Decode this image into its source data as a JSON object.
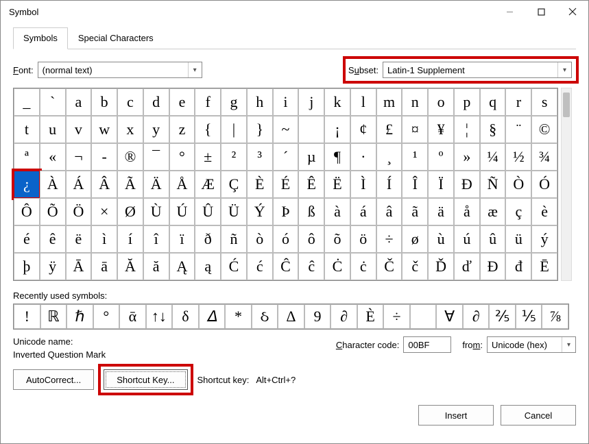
{
  "window": {
    "title": "Symbol"
  },
  "tabs": {
    "symbols": "Symbols",
    "special": "Special Characters"
  },
  "font": {
    "label": "Font:",
    "value": "(normal text)"
  },
  "subset": {
    "label": "Subset:",
    "value": "Latin-1 Supplement"
  },
  "grid": {
    "rows": [
      [
        "_",
        "`",
        "a",
        "b",
        "c",
        "d",
        "e",
        "f",
        "g",
        "h",
        "i",
        "j",
        "k",
        "l",
        "m",
        "n",
        "o",
        "p",
        "q",
        "r",
        "s"
      ],
      [
        "t",
        "u",
        "v",
        "w",
        "x",
        "y",
        "z",
        "{",
        "|",
        "}",
        "~",
        "",
        "¡",
        "¢",
        "£",
        "¤",
        "¥",
        "¦",
        "§",
        "¨",
        "©"
      ],
      [
        "ª",
        "«",
        "¬",
        "-",
        "®",
        "¯",
        "°",
        "±",
        "²",
        "³",
        "´",
        "µ",
        "¶",
        "·",
        "¸",
        "¹",
        "º",
        "»",
        "¼",
        "½",
        "¾"
      ],
      [
        "¿",
        "À",
        "Á",
        "Â",
        "Ã",
        "Ä",
        "Å",
        "Æ",
        "Ç",
        "È",
        "É",
        "Ê",
        "Ë",
        "Ì",
        "Í",
        "Î",
        "Ï",
        "Ð",
        "Ñ",
        "Ò",
        "Ó"
      ],
      [
        "Ô",
        "Õ",
        "Ö",
        "×",
        "Ø",
        "Ù",
        "Ú",
        "Û",
        "Ü",
        "Ý",
        "Þ",
        "ß",
        "à",
        "á",
        "â",
        "ã",
        "ä",
        "å",
        "æ",
        "ç",
        "è"
      ],
      [
        "é",
        "ê",
        "ë",
        "ì",
        "í",
        "î",
        "ï",
        "ð",
        "ñ",
        "ò",
        "ó",
        "ô",
        "õ",
        "ö",
        "÷",
        "ø",
        "ù",
        "ú",
        "û",
        "ü",
        "ý"
      ],
      [
        "þ",
        "ÿ",
        "Ā",
        "ā",
        "Ă",
        "ă",
        "Ą",
        "ą",
        "Ć",
        "ć",
        "Ĉ",
        "ĉ",
        "Ċ",
        "ċ",
        "Č",
        "č",
        "Ď",
        "ď",
        "Đ",
        "đ",
        "Ē"
      ]
    ],
    "selected_row": 3,
    "selected_col": 0
  },
  "recent": {
    "label": "Recently used symbols:",
    "items": [
      "!",
      "ℝ",
      "ℏ",
      "°",
      "ᾱ",
      "↑↓",
      "δ",
      "𝛥",
      "*",
      "ઠ",
      "Δ",
      "9",
      "∂",
      "È",
      "÷",
      "",
      "∀",
      "∂",
      "⅖",
      "⅕",
      "⅞"
    ]
  },
  "unicode": {
    "name_label": "Unicode name:",
    "name_value": "Inverted Question Mark",
    "charcode_label": "Character code:",
    "charcode_value": "00BF",
    "from_label": "from:",
    "from_value": "Unicode (hex)"
  },
  "buttons": {
    "autocorrect": "AutoCorrect...",
    "shortcut": "Shortcut Key...",
    "shortcut_hint_label": "Shortcut key:",
    "shortcut_hint_value": "Alt+Ctrl+?",
    "insert": "Insert",
    "cancel": "Cancel"
  }
}
